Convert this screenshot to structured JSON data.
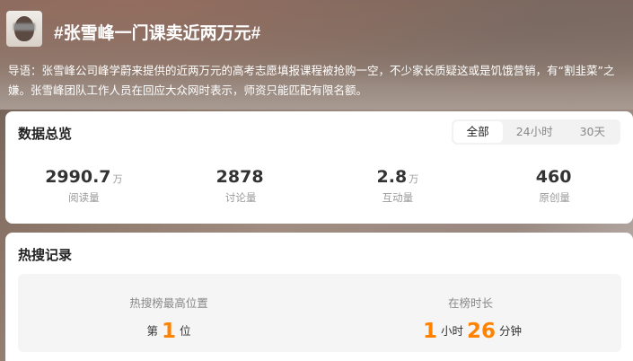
{
  "header": {
    "title": "#张雪峰一门课卖近两万元#",
    "intro": "导语：张雪峰公司峰学蔚来提供的近两万元的高考志愿填报课程被抢购一空，不少家长质疑这或是饥饿营销，有“割韭菜”之嫌。张雪峰团队工作人员在回应大众网时表示，师资只能匹配有限名额。"
  },
  "overview": {
    "heading": "数据总览",
    "tabs": [
      {
        "label": "全部",
        "active": true
      },
      {
        "label": "24小时"
      },
      {
        "label": "30天"
      }
    ],
    "stats": [
      {
        "value": "2990.7",
        "unit": "万",
        "label": "阅读量"
      },
      {
        "value": "2878",
        "unit": "",
        "label": "讨论量"
      },
      {
        "value": "2.8",
        "unit": "万",
        "label": "互动量"
      },
      {
        "value": "460",
        "unit": "",
        "label": "原创量"
      }
    ]
  },
  "hot": {
    "heading": "热搜记录",
    "max_position": {
      "label": "热搜榜最高位置",
      "prefix": "第",
      "value": "1",
      "suffix": "位"
    },
    "duration": {
      "label": "在榜时长",
      "hours": "1",
      "hours_unit": "小时",
      "minutes": "26",
      "minutes_unit": "分钟"
    }
  },
  "colors": {
    "accent": "#ff8200"
  }
}
